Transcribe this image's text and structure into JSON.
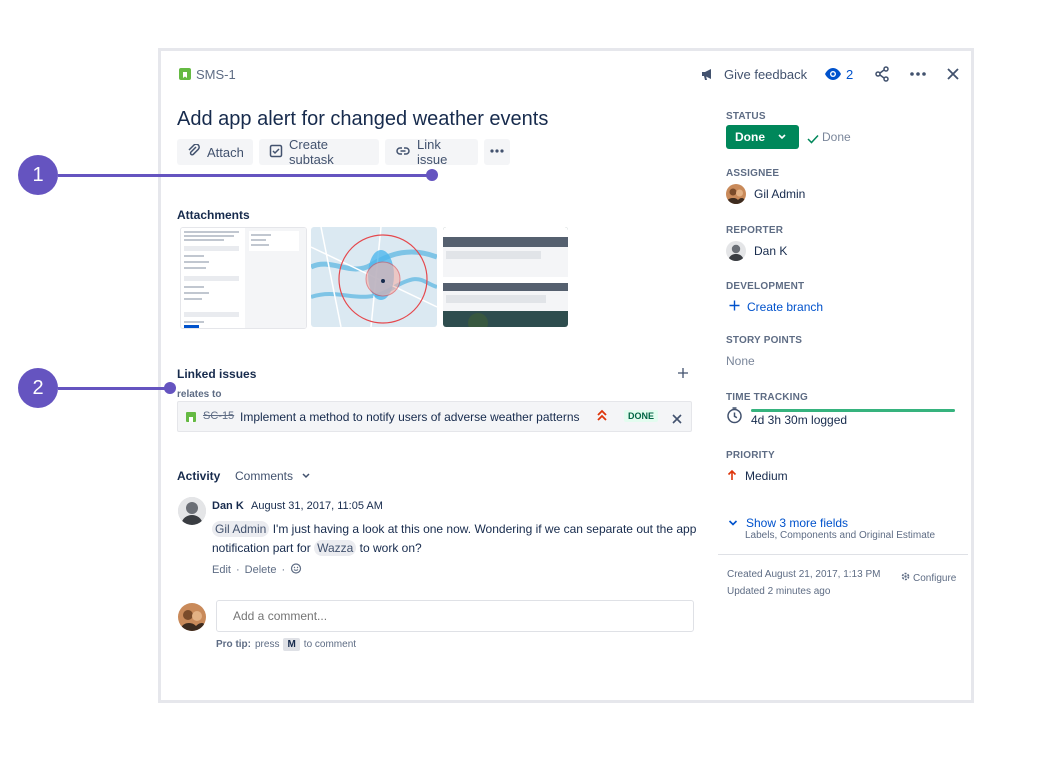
{
  "header": {
    "issue_key": "SMS-1",
    "feedback_label": "Give feedback",
    "watchers_count": "2"
  },
  "issue": {
    "title": "Add app alert for changed weather events"
  },
  "actions": {
    "attach": "Attach",
    "create_subtask": "Create subtask",
    "link_issue": "Link issue"
  },
  "attachments": {
    "heading": "Attachments"
  },
  "linked": {
    "heading": "Linked issues",
    "relation": "relates to",
    "item": {
      "key": "SC-15",
      "summary": "Implement a method to notify users of adverse weather patterns",
      "status": "DONE"
    }
  },
  "activity": {
    "heading": "Activity",
    "filter": "Comments",
    "comment": {
      "author": "Dan K",
      "date": "August 31, 2017, 11:05 AM",
      "mention1": "Gil Admin",
      "text1": "I'm just having a look at this one now. Wondering if we can separate out the app",
      "text2": "notification part for",
      "mention2": "Wazza",
      "text3": "to work on?",
      "edit": "Edit",
      "delete": "Delete",
      "sep": "·"
    },
    "new_comment_placeholder": "Add a comment...",
    "protip_label": "Pro tip:",
    "protip_press": "press",
    "protip_key": "M",
    "protip_rest": "to comment"
  },
  "sidebar": {
    "status_label": "STATUS",
    "status_value": "Done",
    "status_resolution": "Done",
    "assignee_label": "ASSIGNEE",
    "assignee": "Gil Admin",
    "reporter_label": "REPORTER",
    "reporter": "Dan K",
    "development_label": "DEVELOPMENT",
    "create_branch": "Create branch",
    "story_points_label": "STORY POINTS",
    "story_points": "None",
    "time_tracking_label": "TIME TRACKING",
    "time_logged": "4d 3h 30m logged",
    "time_progress": 1.0,
    "priority_label": "PRIORITY",
    "priority": "Medium",
    "show_more": "Show 3 more fields",
    "show_more_sub": "Labels, Components and Original Estimate",
    "created": "Created August 21, 2017, 1:13 PM",
    "updated": "Updated 2 minutes ago",
    "configure": "Configure"
  },
  "callouts": {
    "one": "1",
    "two": "2"
  },
  "colors": {
    "accent": "#0052CC",
    "done_green": "#00875A",
    "callout_purple": "#6554C0",
    "story_green": "#65BA43",
    "priority_red": "#DE350B"
  }
}
